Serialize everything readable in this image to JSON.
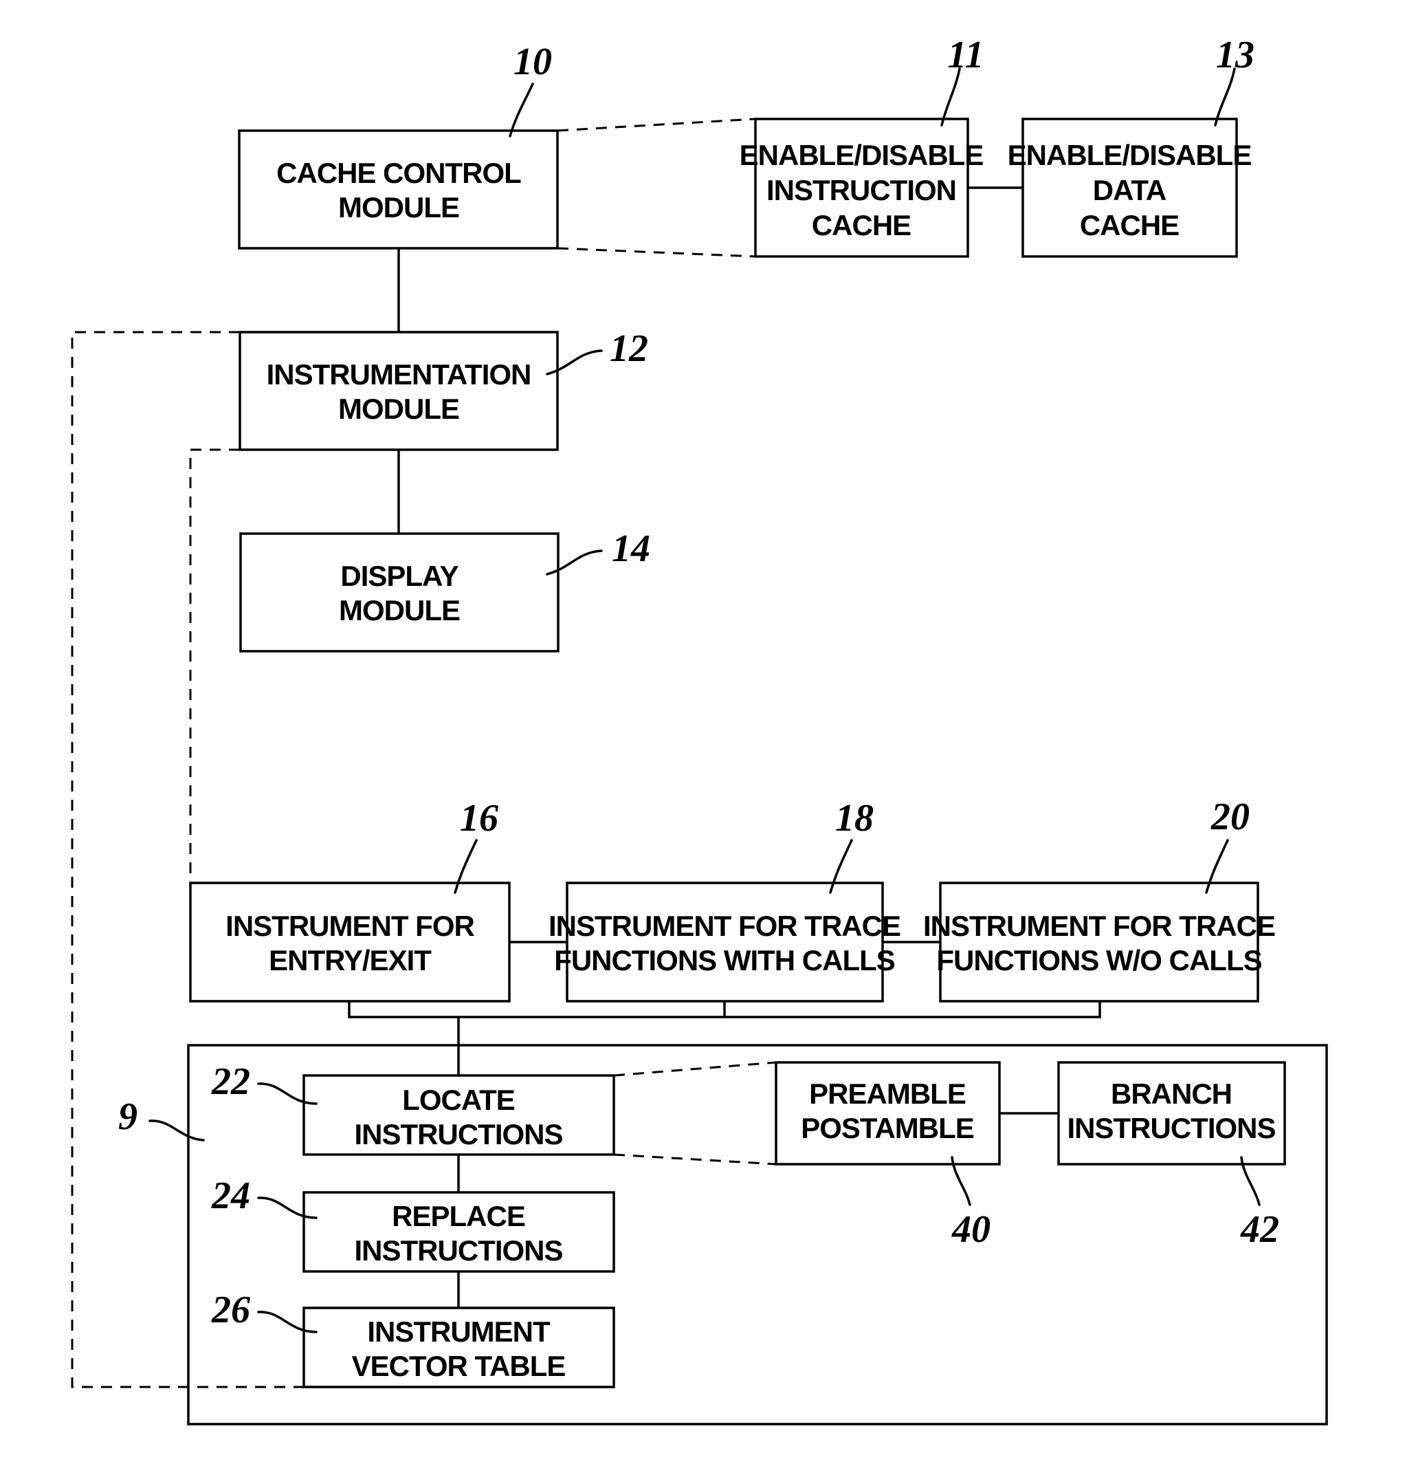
{
  "diagram": {
    "boxes": [
      {
        "id": "10",
        "lines": [
          "CACHE CONTROL",
          "MODULE"
        ]
      },
      {
        "id": "11",
        "lines": [
          "ENABLE/DISABLE",
          "INSTRUCTION",
          "CACHE"
        ]
      },
      {
        "id": "13",
        "lines": [
          "ENABLE/DISABLE",
          "DATA",
          "CACHE"
        ]
      },
      {
        "id": "12",
        "lines": [
          "INSTRUMENTATION",
          "MODULE"
        ]
      },
      {
        "id": "14",
        "lines": [
          "DISPLAY",
          "MODULE"
        ]
      },
      {
        "id": "16",
        "lines": [
          "INSTRUMENT FOR",
          "ENTRY/EXIT"
        ]
      },
      {
        "id": "18",
        "lines": [
          "INSTRUMENT FOR TRACE",
          "FUNCTIONS WITH CALLS"
        ]
      },
      {
        "id": "20",
        "lines": [
          "INSTRUMENT FOR TRACE",
          "FUNCTIONS W/O CALLS"
        ]
      },
      {
        "id": "22",
        "lines": [
          "LOCATE",
          "INSTRUCTIONS"
        ]
      },
      {
        "id": "24",
        "lines": [
          "REPLACE",
          "INSTRUCTIONS"
        ]
      },
      {
        "id": "26",
        "lines": [
          "INSTRUMENT",
          "VECTOR TABLE"
        ]
      },
      {
        "id": "40",
        "lines": [
          "PREAMBLE",
          "POSTAMBLE"
        ]
      },
      {
        "id": "42",
        "lines": [
          "BRANCH",
          "INSTRUCTIONS"
        ]
      }
    ],
    "refs": {
      "r10": "10",
      "r11": "11",
      "r13": "13",
      "r12": "12",
      "r14": "14",
      "r16": "16",
      "r18": "18",
      "r20": "20",
      "r22": "22",
      "r24": "24",
      "r26": "26",
      "r9": "9",
      "r40": "40",
      "r42": "42"
    }
  }
}
